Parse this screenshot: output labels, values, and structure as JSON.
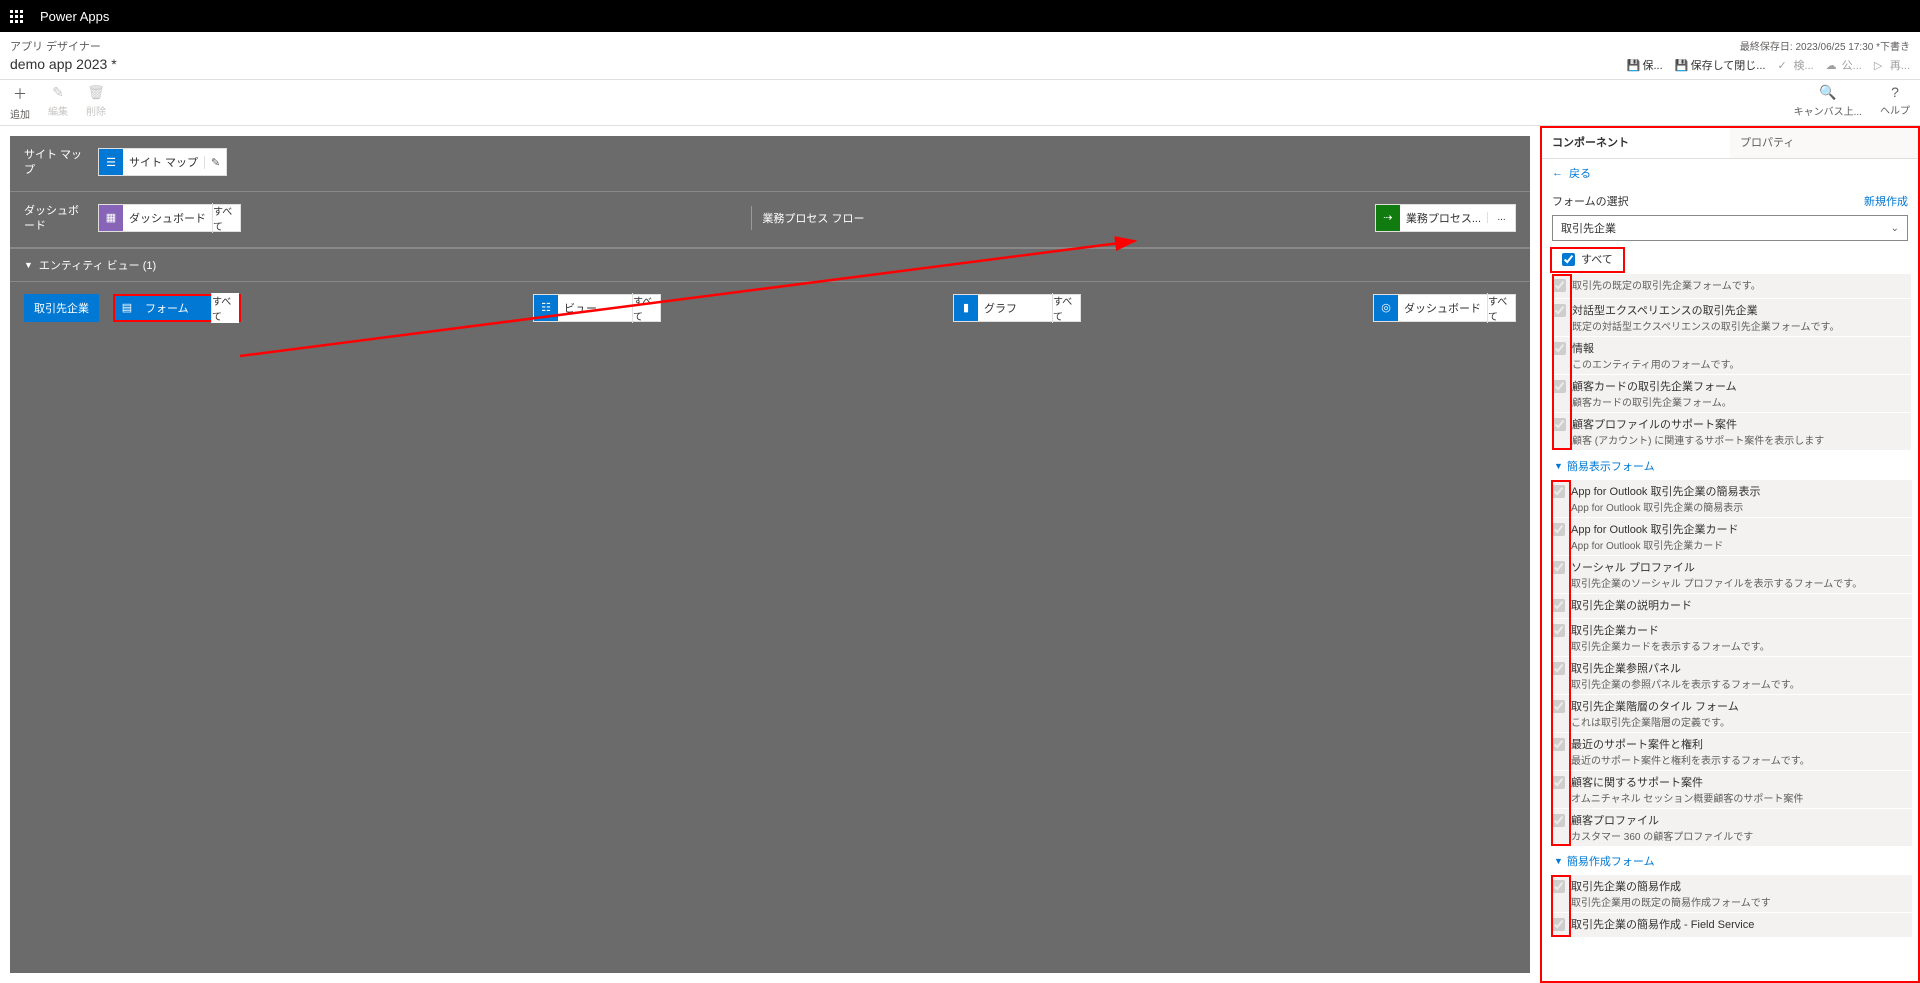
{
  "topbar": {
    "title": "Power Apps"
  },
  "subheader": {
    "designer_label": "アプリ デザイナー",
    "app_name": "demo app 2023 *",
    "last_saved": "最終保存日: 2023/06/25 17:30 *下書き",
    "actions": {
      "save": "保...",
      "save_close": "保存して閉じ...",
      "validate": "検...",
      "publish": "公...",
      "play": "再..."
    }
  },
  "toolbar": {
    "add": "追加",
    "edit": "編集",
    "delete": "削除",
    "canvas": "キャンバス上...",
    "help": "ヘルプ"
  },
  "canvas": {
    "sitemap_label": "サイト マップ",
    "sitemap_tile": "サイト マップ",
    "dashboard_label": "ダッシュボード",
    "dashboard_tile": "ダッシュボード",
    "dashboard_badge": "すべて",
    "bpf_label": "業務プロセス フロー",
    "bpf_tile": "業務プロセス...",
    "bpf_badge": "...",
    "entity_header": "エンティティ ビュー (1)",
    "entity_name": "取引先企業",
    "form_tile": "フォーム",
    "form_badge": "すべて",
    "view_tile": "ビュー",
    "view_badge": "すべて",
    "chart_tile": "グラフ",
    "chart_badge": "すべて",
    "dash_tile": "ダッシュボード",
    "dash_badge": "すべて"
  },
  "panel": {
    "tab_components": "コンポーネント",
    "tab_properties": "プロパティ",
    "back": "戻る",
    "form_select_label": "フォームの選択",
    "new_link": "新規作成",
    "selector_value": "取引先企業",
    "all_label": "すべて",
    "main_forms": [
      {
        "title": "",
        "desc": "取引先の既定の取引先企業フォームです。"
      },
      {
        "title": "対話型エクスペリエンスの取引先企業",
        "desc": "既定の対話型エクスペリエンスの取引先企業フォームです。"
      },
      {
        "title": "情報",
        "desc": "このエンティティ用のフォームです。"
      },
      {
        "title": "顧客カードの取引先企業フォーム",
        "desc": "顧客カードの取引先企業フォーム。"
      },
      {
        "title": "顧客プロファイルのサポート案件",
        "desc": "顧客 (アカウント) に関連するサポート案件を表示します"
      }
    ],
    "quick_view_head": "簡易表示フォーム",
    "quick_view_forms": [
      {
        "title": "App for Outlook 取引先企業の簡易表示",
        "desc": "App for Outlook 取引先企業の簡易表示"
      },
      {
        "title": "App for Outlook 取引先企業カード",
        "desc": "App for Outlook 取引先企業カード"
      },
      {
        "title": "ソーシャル プロファイル",
        "desc": "取引先企業のソーシャル プロファイルを表示するフォームです。"
      },
      {
        "title": "取引先企業の説明カード",
        "desc": ""
      },
      {
        "title": "取引先企業カード",
        "desc": "取引先企業カードを表示するフォームです。"
      },
      {
        "title": "取引先企業参照パネル",
        "desc": "取引先企業の参照パネルを表示するフォームです。"
      },
      {
        "title": "取引先企業階層のタイル フォーム",
        "desc": "これは取引先企業階層の定義です。"
      },
      {
        "title": "最近のサポート案件と権利",
        "desc": "最近のサポート案件と権利を表示するフォームです。"
      },
      {
        "title": "顧客に関するサポート案件",
        "desc": "オムニチャネル セッション概要顧客のサポート案件"
      },
      {
        "title": "顧客プロファイル",
        "desc": "カスタマー 360 の顧客プロファイルです"
      }
    ],
    "quick_create_head": "簡易作成フォーム",
    "quick_create_forms": [
      {
        "title": "取引先企業の簡易作成",
        "desc": "取引先企業用の既定の簡易作成フォームです"
      },
      {
        "title": "取引先企業の簡易作成 - Field Service",
        "desc": ""
      }
    ]
  }
}
